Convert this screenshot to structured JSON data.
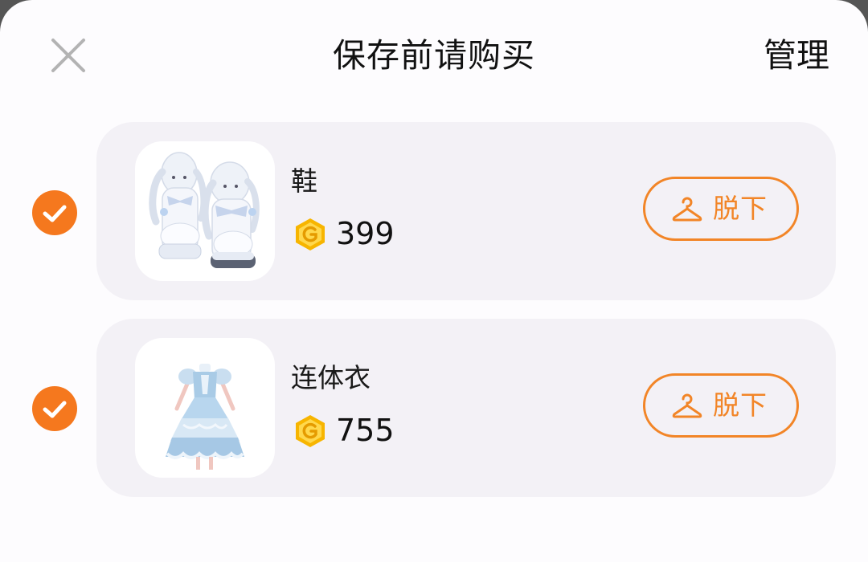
{
  "header": {
    "title": "保存前请购买",
    "manage_label": "管理",
    "close_icon": "close-icon"
  },
  "items": [
    {
      "checked": true,
      "name": "鞋",
      "price": "399",
      "action_label": "脱下",
      "thumbnail": "bunny-boots-image"
    },
    {
      "checked": true,
      "name": "连体衣",
      "price": "755",
      "action_label": "脱下",
      "thumbnail": "blue-lolita-dress-image"
    }
  ],
  "colors": {
    "accent": "#f5781e",
    "button_border": "#f28527",
    "card_bg": "#f3f1f6",
    "coin": "#f7b500"
  }
}
